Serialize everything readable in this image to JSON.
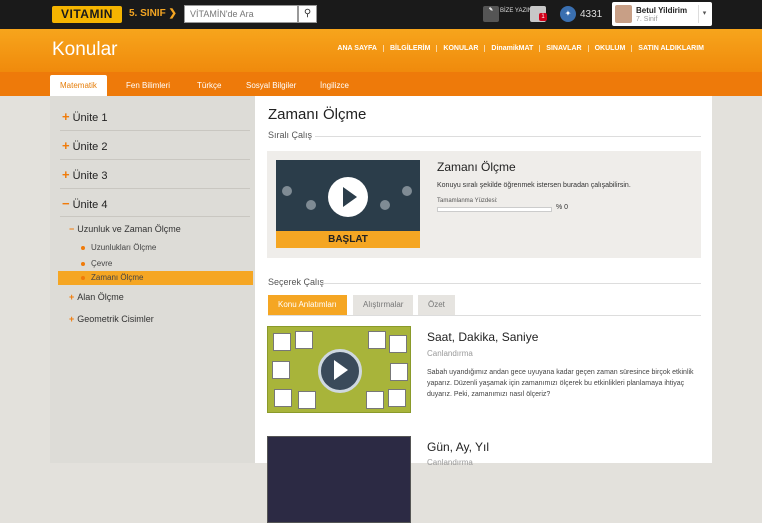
{
  "topbar": {
    "logo": "VITAMIN",
    "grade": "5. SINIF ❯",
    "search_placeholder": "VİTAMİN'de Ara",
    "search_icon": "search-icon",
    "write_label": "BİZE YAZIN",
    "mail_badge": "1",
    "points": "4331",
    "user_name": "Betul Yildirim",
    "user_class": "7. Sinif",
    "dropdown_icon": "▾"
  },
  "banner": {
    "title": "Konular",
    "nav": [
      "ANA SAYFA",
      "BİLGİLERİM",
      "KONULAR",
      "DinamikMAT",
      "SINAVLAR",
      "OKULUM",
      "SATIN ALDIKLARIM"
    ]
  },
  "subjects": [
    "Matematik",
    "Fen Bilimleri",
    "Türkçe",
    "Sosyal Bilgiler",
    "İngilizce"
  ],
  "sidebar": {
    "units": [
      {
        "sign": "+",
        "label": "Ünite 1"
      },
      {
        "sign": "+",
        "label": "Ünite 2"
      },
      {
        "sign": "+",
        "label": "Ünite 3"
      },
      {
        "sign": "−",
        "label": "Ünite 4"
      }
    ],
    "subs": [
      {
        "sign": "−",
        "label": "Uzunluk ve Zaman Ölçme"
      },
      {
        "sign": "+",
        "label": "Alan Ölçme"
      },
      {
        "sign": "+",
        "label": "Geometrik Cisimler"
      }
    ],
    "leaves": [
      "Uzunlukları Ölçme",
      "Çevre",
      "Zamanı Ölçme"
    ]
  },
  "main": {
    "title": "Zamanı Ölçme",
    "section1": "Sıralı Çalış",
    "card": {
      "title": "Zamanı Ölçme",
      "description": "Konuyu sıralı şekilde öğrenmek istersen buradan çalışabilirsin.",
      "progress_label": "Tamamlanma Yüzdesi:",
      "progress_value": "% 0",
      "start_label": "BAŞLAT"
    },
    "section2": "Seçerek Çalış",
    "tabs": [
      "Konu Anlatımları",
      "Alıştırmalar",
      "Özet"
    ],
    "items": [
      {
        "title": "Saat, Dakika, Saniye",
        "type": "Canlandırma",
        "description": "Sabah uyandığımız andan gece uyuyana kadar geçen zaman süresince birçok etkinlik yaparız. Düzenli yaşamak için zamanımızı ölçerek bu etkinlikleri planlamaya ihtiyaç duyarız. Peki, zamanımızı nasıl ölçeriz?"
      },
      {
        "title": "Gün, Ay, Yıl",
        "type": "Canlandırma"
      }
    ]
  }
}
